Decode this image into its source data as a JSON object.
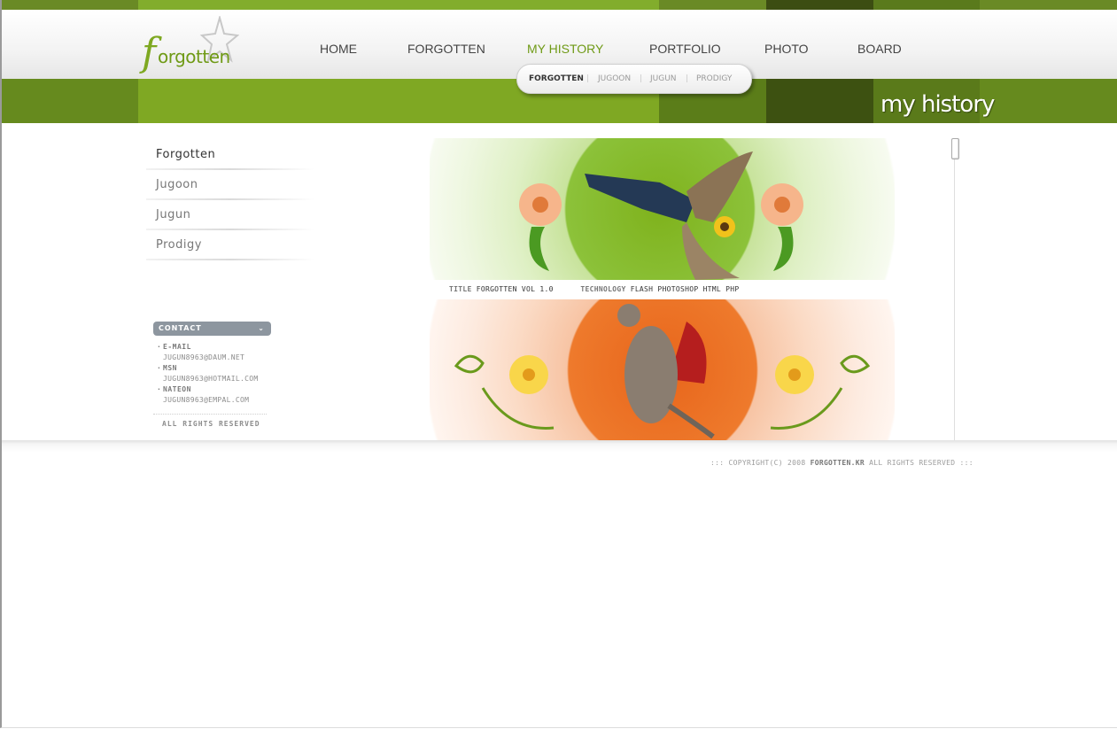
{
  "colors": {
    "top_strip": [
      "#6a8a25",
      "#82ad2c",
      "#6a8a25",
      "#3c4d12",
      "#5a7a1c",
      "#6a8a25"
    ],
    "band": [
      "#668a1e",
      "#7fa823",
      "#5b7d19",
      "#3d5111",
      "#5a7a1a",
      "#668a1e"
    ],
    "accent": "#6f9a16"
  },
  "logo": {
    "initial": "f",
    "text": "orgotten"
  },
  "nav": {
    "items": [
      "HOME",
      "FORGOTTEN",
      "MY HISTORY",
      "PORTFOLIO",
      "PHOTO",
      "BOARD"
    ],
    "active_index": 2
  },
  "subnav": {
    "items": [
      "FORGOTTEN",
      "JUGOON",
      "JUGUN",
      "PRODIGY"
    ],
    "separator": "|",
    "active_index": 0
  },
  "band_title": "my history",
  "left_menu": {
    "items": [
      "Forgotten",
      "Jugoon",
      "Jugun",
      "Prodigy"
    ],
    "active_index": 0
  },
  "contact": {
    "title": "CONTACT",
    "chevron": "⌄",
    "entries": [
      {
        "label": "E-MAIL",
        "value": "JUGUN8963@DAUM.NET"
      },
      {
        "label": "MSN",
        "value": "JUGUN8963@HOTMAIL.COM"
      },
      {
        "label": "NATEON",
        "value": "JUGUN8963@EMPAL.COM"
      }
    ],
    "reserved": "ALL RIGHTS RESERVED"
  },
  "portfolio": {
    "items": [
      {
        "title_label": "TITLE",
        "title": "FORGOTTEN VOL 1.0",
        "technology_label": "TECHNOLOGY",
        "technology": "FLASH PHOTOSHOP HTML PHP",
        "image": "green-flower-wings-illustration"
      },
      {
        "image": "orange-flying-cat-illustration"
      }
    ]
  },
  "footer": {
    "prefix": ":::",
    "copyright": "COPYRIGHT(C) 2008",
    "domain": "FORGOTTEN.KR",
    "suffix": "ALL RIGHTS RESERVED",
    "end": ":::"
  }
}
